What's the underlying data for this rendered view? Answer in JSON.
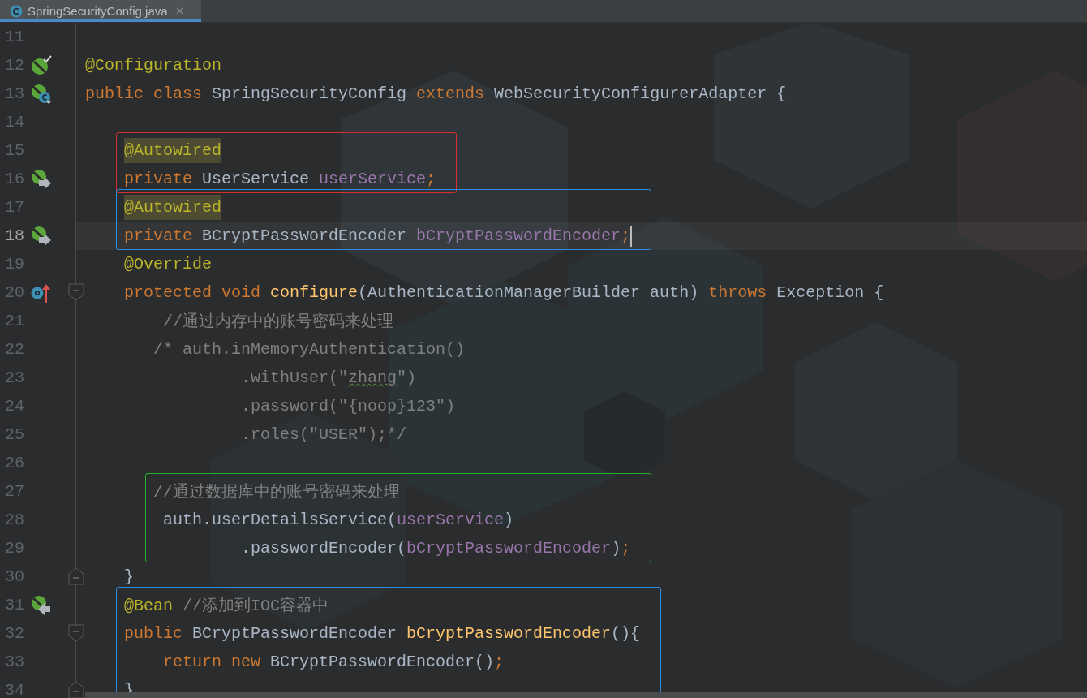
{
  "tab": {
    "title": "SpringSecurityConfig.java",
    "close": "×",
    "selected": true
  },
  "lines": [
    {
      "kind": "line",
      "number": "11"
    },
    {
      "kind": "line",
      "number": "12",
      "gutter_icon": {
        "kind": "bean_check"
      },
      "tokens": [
        {
          "kind": "annotation",
          "text": "@Configuration"
        }
      ]
    },
    {
      "kind": "line",
      "number": "13",
      "gutter_icon": {
        "kind": "bean_class"
      },
      "tokens": [
        {
          "kind": "keyword",
          "text": "public class "
        },
        {
          "kind": "plain",
          "text": "SpringSecurityConfig "
        },
        {
          "kind": "keyword",
          "text": "extends "
        },
        {
          "kind": "plain",
          "text": "WebSecurityConfigurerAdapter {"
        }
      ]
    },
    {
      "kind": "line",
      "number": "14"
    },
    {
      "kind": "frame",
      "color": "#d32f2f",
      "lines": [
        {
          "kind": "line",
          "number": "15",
          "indent": {
            "kind": "member"
          },
          "tokens": [
            {
              "kind": "annotation_marked",
              "text": "@Autowired"
            }
          ]
        },
        {
          "kind": "line",
          "number": "16",
          "indent": {
            "kind": "member"
          },
          "gutter_icon": {
            "kind": "autowire_out"
          },
          "tokens": [
            {
              "kind": "keyword",
              "text": "private "
            },
            {
              "kind": "plain",
              "text": "UserService "
            },
            {
              "kind": "field",
              "text": "userService"
            },
            {
              "kind": "keyword",
              "text": ";"
            }
          ]
        }
      ]
    },
    {
      "kind": "frame",
      "color": "#2f8be0",
      "lines": [
        {
          "kind": "line",
          "number": "17",
          "indent": {
            "kind": "member"
          },
          "tokens": [
            {
              "kind": "annotation_marked",
              "text": "@Autowired"
            }
          ]
        },
        {
          "kind": "line",
          "number": "18",
          "indent": {
            "kind": "member"
          },
          "gutter_icon": {
            "kind": "autowire_out"
          },
          "current": true,
          "caret": true,
          "tokens": [
            {
              "kind": "keyword",
              "text": "private "
            },
            {
              "kind": "plain",
              "text": "BCryptPasswordEncoder "
            },
            {
              "kind": "field",
              "text": "bCryptPasswordEncoder"
            },
            {
              "kind": "keyword",
              "text": ";"
            }
          ]
        }
      ]
    },
    {
      "kind": "line",
      "number": "19",
      "indent": {
        "kind": "member"
      },
      "tokens": [
        {
          "kind": "annotation",
          "text": "@Override"
        }
      ]
    },
    {
      "kind": "line",
      "number": "20",
      "indent": {
        "kind": "member"
      },
      "gutter_icon": {
        "kind": "override"
      },
      "fold": {
        "kind": "open"
      },
      "tokens": [
        {
          "kind": "keyword",
          "text": "protected void "
        },
        {
          "kind": "method",
          "text": "configure"
        },
        {
          "kind": "plain",
          "text": "(AuthenticationManagerBuilder auth) "
        },
        {
          "kind": "keyword",
          "text": "throws "
        },
        {
          "kind": "plain",
          "text": "Exception {"
        }
      ]
    },
    {
      "kind": "line",
      "number": "21",
      "indent": {
        "kind": "body"
      },
      "tokens": [
        {
          "kind": "comment",
          "text": "//通过内存中的账号密码来处理"
        }
      ]
    },
    {
      "kind": "line",
      "number": "22",
      "indent": {
        "kind": "body_outdent"
      },
      "tokens": [
        {
          "kind": "comment",
          "text": "/* auth.inMemoryAuthentication()"
        }
      ]
    },
    {
      "kind": "line",
      "number": "23",
      "indent": {
        "kind": "chain"
      },
      "tokens": [
        {
          "kind": "comment",
          "text": ".withUser(\""
        },
        {
          "kind": "typo",
          "text": "zhang"
        },
        {
          "kind": "comment",
          "text": "\")"
        }
      ]
    },
    {
      "kind": "line",
      "number": "24",
      "indent": {
        "kind": "chain"
      },
      "tokens": [
        {
          "kind": "comment",
          "text": ".password(\"{noop}123\")"
        }
      ]
    },
    {
      "kind": "line",
      "number": "25",
      "indent": {
        "kind": "chain"
      },
      "tokens": [
        {
          "kind": "comment",
          "text": ".roles(\"USER\");*/"
        }
      ]
    },
    {
      "kind": "line",
      "number": "26"
    },
    {
      "kind": "frame",
      "color": "#22b422",
      "lines": [
        {
          "kind": "line",
          "number": "27",
          "indent": {
            "kind": "body_outdent"
          },
          "tokens": [
            {
              "kind": "comment",
              "text": "//通过数据库中的账号密码来处理"
            }
          ]
        },
        {
          "kind": "line",
          "number": "28",
          "indent": {
            "kind": "body"
          },
          "tokens": [
            {
              "kind": "plain",
              "text": "auth.userDetailsService("
            },
            {
              "kind": "field",
              "text": "userService"
            },
            {
              "kind": "plain",
              "text": ")"
            }
          ]
        },
        {
          "kind": "line",
          "number": "29",
          "indent": {
            "kind": "chain"
          },
          "tokens": [
            {
              "kind": "plain",
              "text": ".passwordEncoder("
            },
            {
              "kind": "field",
              "text": "bCryptPasswordEncoder"
            },
            {
              "kind": "plain",
              "text": ")"
            },
            {
              "kind": "keyword",
              "text": ";"
            }
          ]
        }
      ]
    },
    {
      "kind": "line",
      "number": "30",
      "indent": {
        "kind": "member"
      },
      "fold": {
        "kind": "close"
      },
      "tokens": [
        {
          "kind": "plain",
          "text": "}"
        }
      ]
    },
    {
      "kind": "frame",
      "color": "#2f8be0",
      "lines": [
        {
          "kind": "line",
          "number": "31",
          "indent": {
            "kind": "member"
          },
          "gutter_icon": {
            "kind": "bean_in"
          },
          "tokens": [
            {
              "kind": "annotation",
              "text": "@Bean "
            },
            {
              "kind": "comment",
              "text": "//添加到IOC容器中"
            }
          ]
        },
        {
          "kind": "line",
          "number": "32",
          "indent": {
            "kind": "member"
          },
          "fold": {
            "kind": "open"
          },
          "tokens": [
            {
              "kind": "keyword",
              "text": "public "
            },
            {
              "kind": "plain",
              "text": "BCryptPasswordEncoder "
            },
            {
              "kind": "method",
              "text": "bCryptPasswordEncoder"
            },
            {
              "kind": "plain",
              "text": "(){"
            }
          ]
        },
        {
          "kind": "line",
          "number": "33",
          "indent": {
            "kind": "body"
          },
          "tokens": [
            {
              "kind": "keyword",
              "text": "return new "
            },
            {
              "kind": "plain",
              "text": "BCryptPasswordEncoder()"
            },
            {
              "kind": "keyword",
              "text": ";"
            }
          ]
        },
        {
          "kind": "line",
          "number": "34",
          "indent": {
            "kind": "member"
          },
          "fold": {
            "kind": "close"
          },
          "tokens": [
            {
              "kind": "plain",
              "text": "}"
            }
          ]
        }
      ]
    }
  ]
}
